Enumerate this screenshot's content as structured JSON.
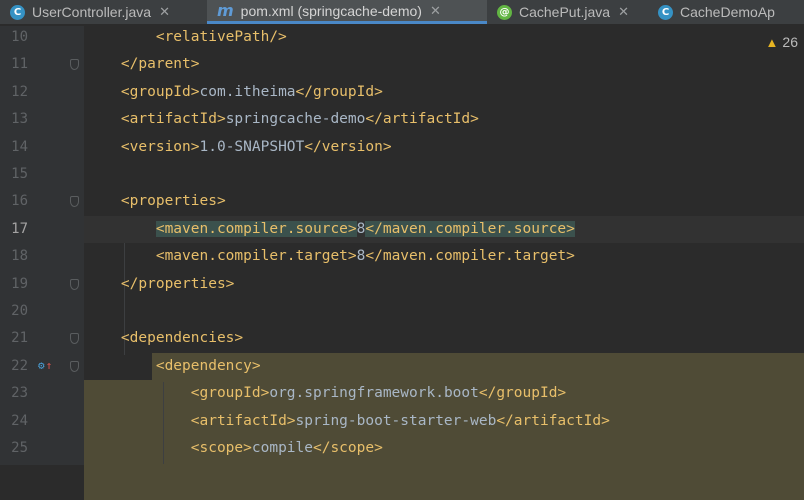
{
  "tabs": [
    {
      "label": "UserController.java",
      "icon": "class-icon",
      "icon_text": "C",
      "color": "#3592c4",
      "close": "✕"
    },
    {
      "label": "pom.xml (springcache-demo)",
      "icon": "maven-icon",
      "icon_text": "m",
      "color": "#5f9bd6",
      "close": "✕",
      "active": true
    },
    {
      "label": "CachePut.java",
      "icon": "annotation-icon",
      "icon_text": "@",
      "color": "#62b543",
      "close": "✕"
    },
    {
      "label": "CacheDemoAp",
      "icon": "spring-class-icon",
      "icon_text": "C",
      "color": "#3592c4"
    }
  ],
  "warnings": {
    "count": "26",
    "icon": "warning-triangle-icon"
  },
  "lines": [
    {
      "n": "10",
      "indent": "        ",
      "text": "<relativePath/>"
    },
    {
      "n": "11",
      "indent": "    ",
      "text": "</parent>"
    },
    {
      "n": "12",
      "indent": "    ",
      "open": "<groupId>",
      "value": "com.itheima",
      "close": "</groupId>"
    },
    {
      "n": "13",
      "indent": "    ",
      "open": "<artifactId>",
      "value": "springcache-demo",
      "close": "</artifactId>"
    },
    {
      "n": "14",
      "indent": "    ",
      "open": "<version>",
      "value": "1.0-SNAPSHOT",
      "close": "</version>"
    },
    {
      "n": "15",
      "indent": "",
      "text": ""
    },
    {
      "n": "16",
      "indent": "    ",
      "text": "<properties>"
    },
    {
      "n": "17",
      "indent": "        ",
      "open": "<maven.compiler.source>",
      "value": "8",
      "close": "</maven.compiler.source>"
    },
    {
      "n": "18",
      "indent": "        ",
      "open": "<maven.compiler.target>",
      "value": "8",
      "close": "</maven.compiler.target>"
    },
    {
      "n": "19",
      "indent": "    ",
      "text": "</properties>"
    },
    {
      "n": "20",
      "indent": "",
      "text": ""
    },
    {
      "n": "21",
      "indent": "    ",
      "text": "<dependencies>"
    },
    {
      "n": "22",
      "indent": "        ",
      "text": "<dependency>"
    },
    {
      "n": "23",
      "indent": "            ",
      "open": "<groupId>",
      "value": "org.springframework.boot",
      "close": "</groupId>"
    },
    {
      "n": "24",
      "indent": "            ",
      "open": "<artifactId>",
      "value": "spring-boot-starter-web",
      "close": "</artifactId>"
    },
    {
      "n": "25",
      "indent": "            ",
      "open": "<scope>",
      "value": "compile",
      "close": "</scope>"
    }
  ],
  "current_line": "17",
  "colors": {
    "tag": "#e8bf6a",
    "text": "#a9b7c6",
    "background": "#2b2b2b",
    "gutter": "#313335",
    "block_highlight": "#4f4b36",
    "tag_highlight": "#3b514d"
  }
}
